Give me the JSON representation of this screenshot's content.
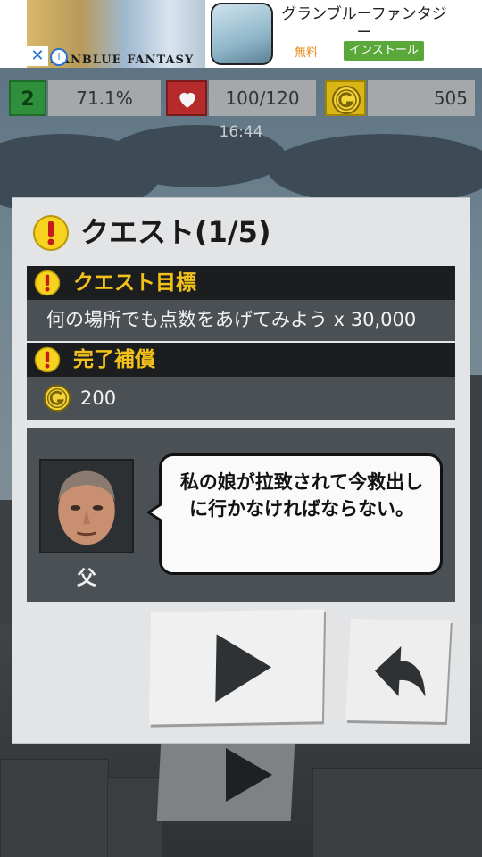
{
  "ad": {
    "title": "グランブルーファンタジー",
    "price": "無料",
    "install_label": "インストール",
    "art_caption": "GRANBLUE FANTASY",
    "close_glyph": "✕",
    "info_glyph": "i"
  },
  "status": {
    "level": "2",
    "exp_percent": "71.1%",
    "hp": "100/120",
    "coins": "505",
    "time": "16:44"
  },
  "quest": {
    "title": "クエスト(1/5)",
    "goal_header": "クエスト目標",
    "goal_text": "何の場所でも点数をあげてみよう x 30,000",
    "reward_header": "完了補償",
    "reward_amount": "200",
    "npc_name": "父",
    "dialogue": "私の娘が拉致されて今救出しに行かなければならない。"
  },
  "icons": {
    "title": "warning-icon",
    "goal": "warning-icon",
    "reward": "warning-icon",
    "coin": "gold-coin-icon",
    "hp": "heart-icon",
    "play": "play-icon",
    "back": "return-arrow-icon"
  },
  "colors": {
    "warning_yellow": "#f2c21a",
    "coin_gold": "#d9b615",
    "hp_red": "#b52a2a",
    "level_green": "#2f8f3a"
  }
}
